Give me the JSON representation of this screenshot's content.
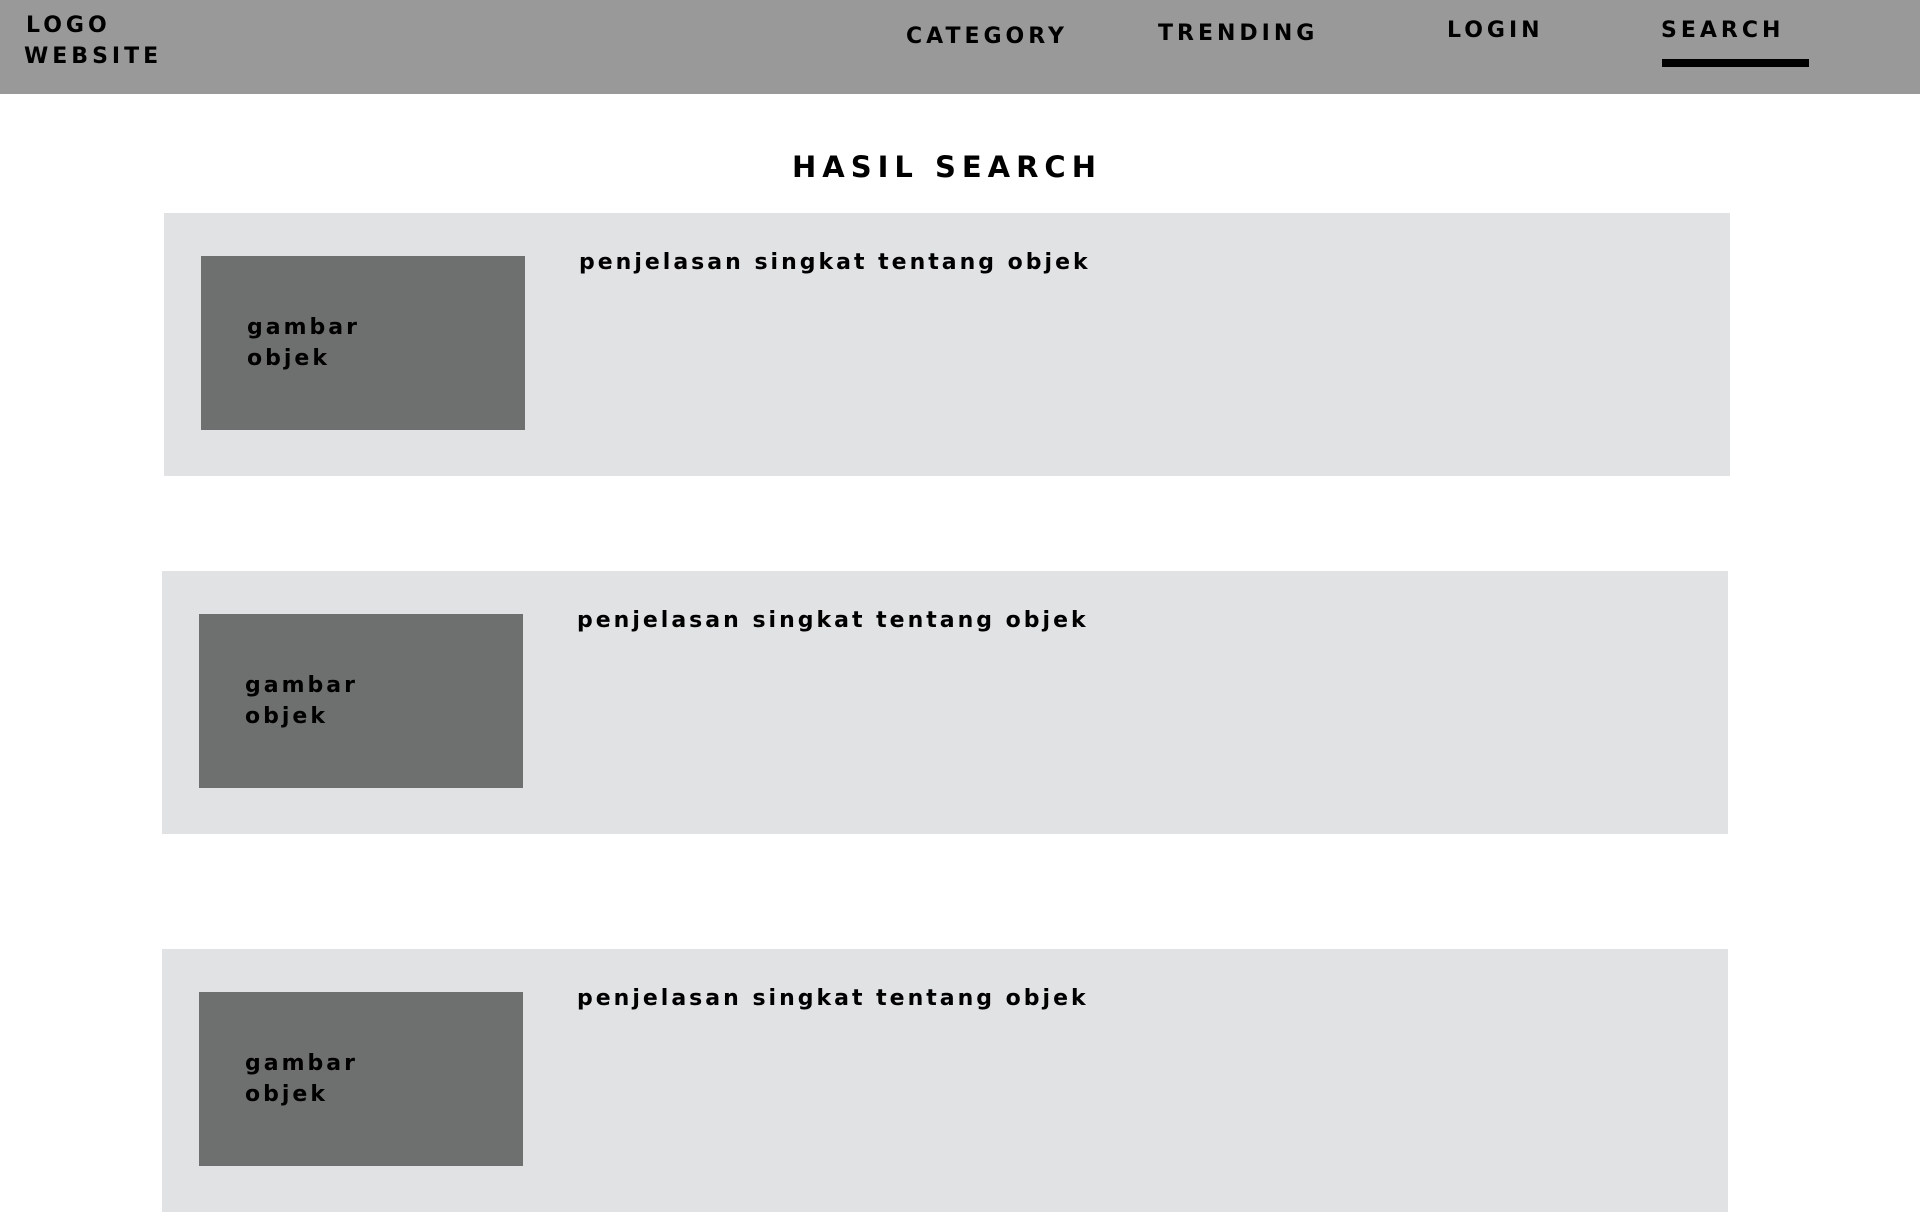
{
  "header": {
    "logo_line1": "LOGO",
    "logo_line2": "WEBSITE",
    "nav": {
      "category": "CATEGORY",
      "trending": "TRENDING",
      "login": "LOGIN",
      "search": "SEARCH"
    },
    "active_nav": "SEARCH"
  },
  "main": {
    "title": "HASIL SEARCH",
    "results": [
      {
        "image_label": "gambar objek",
        "description": "penjelasan singkat tentang objek"
      },
      {
        "image_label": "gambar objek",
        "description": "penjelasan singkat tentang objek"
      },
      {
        "image_label": "gambar objek",
        "description": "penjelasan singkat tentang objek"
      }
    ]
  },
  "colors": {
    "header_bg": "#999999",
    "card_bg": "#e1e2e4",
    "thumb_bg": "#6e706f",
    "text": "#000000"
  }
}
